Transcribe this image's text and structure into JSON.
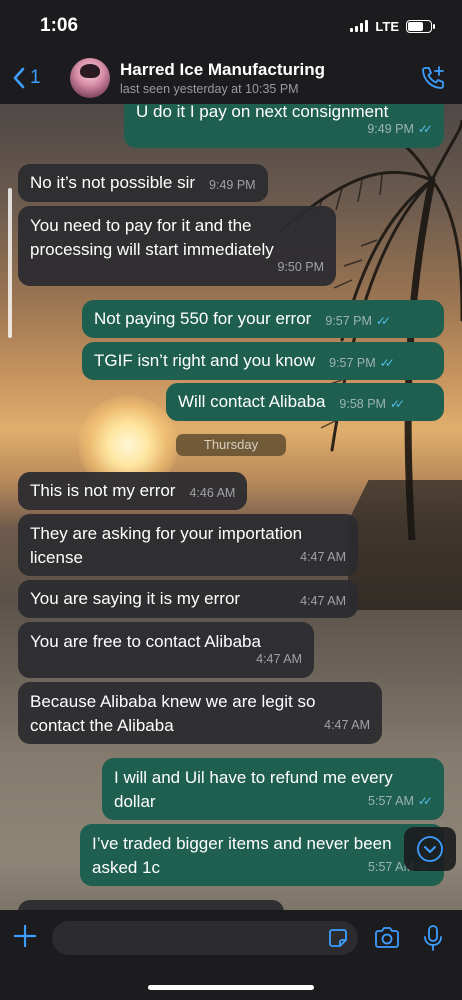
{
  "status": {
    "time": "1:06",
    "network": "LTE"
  },
  "header": {
    "back_count": "1",
    "contact_name": "Harred Ice Manufacturing",
    "last_seen": "last seen yesterday at 10:35 PM"
  },
  "messages": [
    {
      "dir": "out",
      "text": "U do it I pay on next consignment",
      "time": "9:49 PM",
      "read": true
    },
    {
      "dir": "in",
      "text": "No it’s not possible sir",
      "time": "9:49 PM"
    },
    {
      "dir": "in",
      "text": "You need to pay for it and the processing will start immediately",
      "time": "9:50 PM"
    },
    {
      "dir": "out",
      "text": "Not paying 550 for your error",
      "time": "9:57 PM",
      "read": true
    },
    {
      "dir": "out",
      "text": "TGIF isn’t right and you know",
      "time": "9:57 PM",
      "read": true
    },
    {
      "dir": "out",
      "text": "Will contact Alibaba",
      "time": "9:58 PM",
      "read": true
    },
    {
      "dir": "in",
      "text": "This is not my error",
      "time": "4:46 AM"
    },
    {
      "dir": "in",
      "text": "They are asking for your importation license",
      "time": "4:47 AM"
    },
    {
      "dir": "in",
      "text": "You are saying it is my error",
      "time": "4:47 AM"
    },
    {
      "dir": "in",
      "text": "You are free to contact Alibaba",
      "time": "4:47 AM"
    },
    {
      "dir": "in",
      "text": "Because Alibaba knew we are legit so contact the Alibaba",
      "time": "4:47 AM"
    },
    {
      "dir": "out",
      "text": "I will and Uil have to refund me every dollar",
      "time": "5:57 AM",
      "read": true
    },
    {
      "dir": "out",
      "text": "I’ve traded bigger items and never been asked 1c",
      "time": "5:57 AM",
      "read": true
    }
  ],
  "day_separator": "Thursday",
  "colors": {
    "accent": "#3d9eff",
    "incoming_bubble": "#2c2c30",
    "outgoing_bubble": "#1f5f4f",
    "read_ticks": "#53bdeb"
  },
  "icons": {
    "back": "chevron-left-icon",
    "call": "phone-plus-icon",
    "attach": "plus-icon",
    "sticker": "sticker-icon",
    "camera": "camera-icon",
    "mic": "microphone-icon",
    "scroll": "chevron-down-icon"
  }
}
